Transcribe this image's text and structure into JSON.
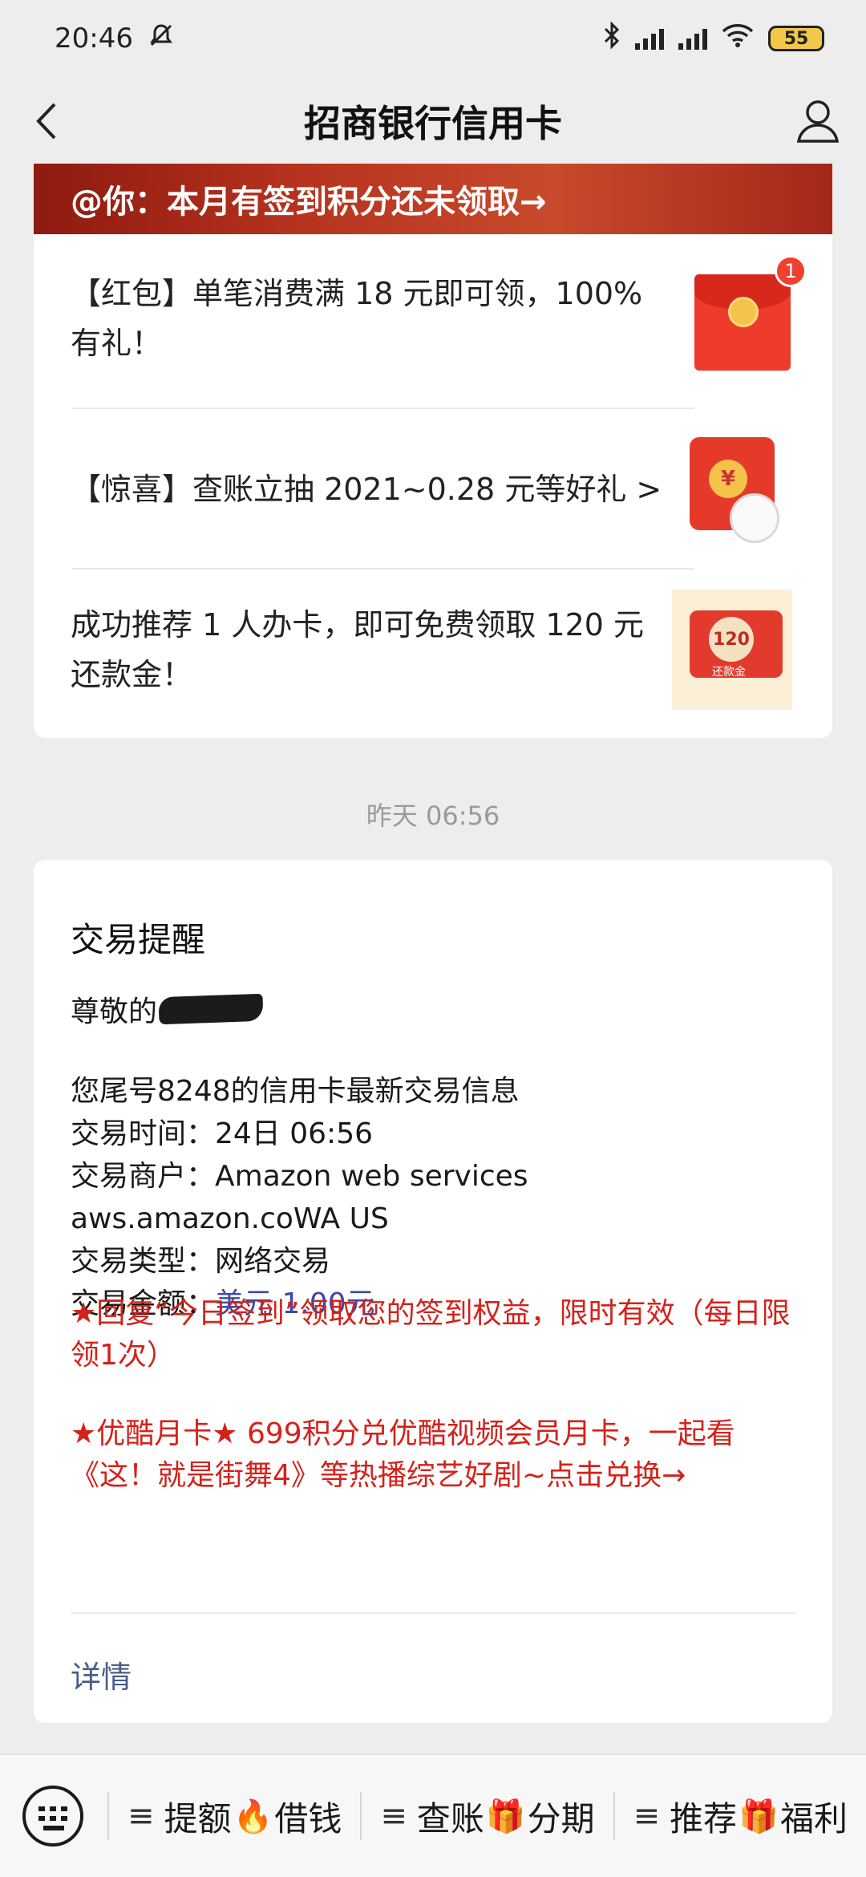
{
  "status": {
    "time": "20:46",
    "battery": "55"
  },
  "nav": {
    "title": "招商银行信用卡"
  },
  "promo": {
    "banner": "@你：本月有签到积分还未领取→",
    "items": [
      {
        "text": "【红包】单笔消费满 18 元即可领，100% 有礼！",
        "badge": "1"
      },
      {
        "text": "【惊喜】查账立抽 2021~0.28 元等好礼 >"
      },
      {
        "text": "成功推荐 1 人办卡，即可免费领取 120 元还款金！",
        "thumb_value": "120",
        "thumb_label": "还款金"
      }
    ]
  },
  "timestamp": "昨天 06:56",
  "message": {
    "title": "交易提醒",
    "greeting": "尊敬的",
    "lines": [
      "您尾号8248的信用卡最新交易信息",
      "交易时间：24日 06:56",
      "交易商户：Amazon web services",
      "aws.amazon.coWA US",
      "交易类型：网络交易"
    ],
    "amount_label": "交易金额：",
    "amount_value": "美元 1.00元",
    "note1": "★回复“今日签到”领取您的签到权益，限时有效（每日限领1次）",
    "note2": "★优酷月卡★ 699积分兑优酷视频会员月卡，一起看《这！就是街舞4》等热播综艺好剧~点击兑换→",
    "details": "详情"
  },
  "bottom_menu": [
    {
      "pre": "提额",
      "emoji": "🔥",
      "post": "借钱"
    },
    {
      "pre": "查账",
      "emoji": "🎁",
      "post": "分期"
    },
    {
      "pre": "推荐",
      "emoji": "🎁",
      "post": "福利"
    }
  ]
}
